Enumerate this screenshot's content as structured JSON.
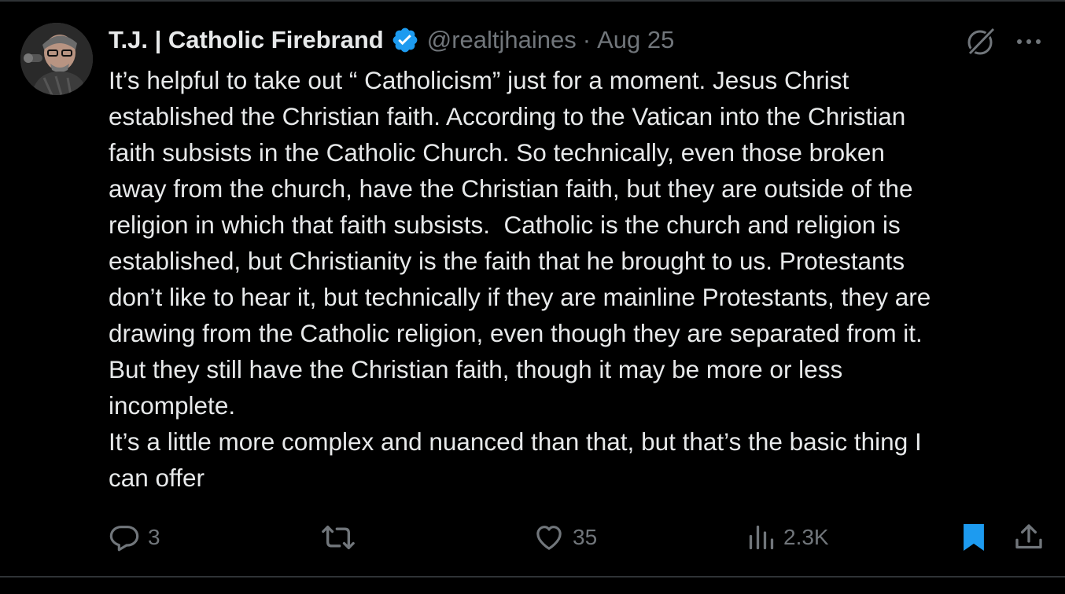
{
  "tweet": {
    "author": {
      "display_name": "T.J. | Catholic Firebrand",
      "handle": "@realtjhaines",
      "separator": "·",
      "date": "Aug 25"
    },
    "text_lines": [
      "It’s helpful to take out “ Catholicism” just for a moment. Jesus Christ",
      "established the Christian faith. According to the Vatican into the Christian",
      "faith subsists in the Catholic Church. So technically, even those broken",
      "away from the church, have the Christian faith, but they are outside of the",
      "religion in which that faith subsists.  Catholic is the church and religion is",
      "established, but Christianity is the faith that he brought to us. Protestants",
      "don’t like to hear it, but technically if they are mainline Protestants, they are",
      "drawing from the Catholic religion, even though they are separated from it.",
      "But they still have the Christian faith, though it may be more or less",
      "incomplete.",
      "It’s a little more complex and nuanced than that, but that’s the basic thing I",
      "can offer"
    ],
    "actions": {
      "reply": {
        "icon": "reply-icon",
        "count": "3"
      },
      "repost": {
        "icon": "repost-icon",
        "count": ""
      },
      "like": {
        "icon": "heart-icon",
        "count": "35"
      },
      "views": {
        "icon": "views-icon",
        "count": "2.3K"
      },
      "bookmark": {
        "icon": "bookmark-icon",
        "state": "bookmarked"
      },
      "share": {
        "icon": "share-icon"
      }
    }
  },
  "colors": {
    "background": "#000000",
    "text": "#e7e9ea",
    "muted": "#71767b",
    "accent": "#1d9bf0",
    "border": "#2f3336"
  }
}
